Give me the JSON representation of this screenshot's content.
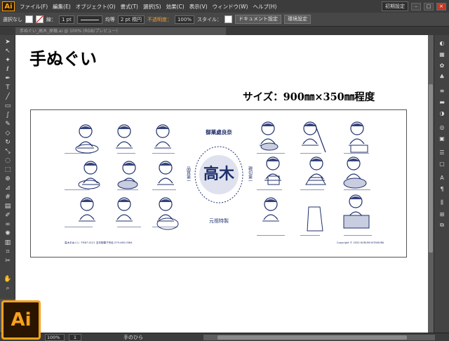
{
  "app": {
    "logo": "Ai",
    "menu": [
      "ファイル(F)",
      "編集(E)",
      "オブジェクト(O)",
      "書式(T)",
      "選択(S)",
      "効果(C)",
      "表示(V)",
      "ウィンドウ(W)",
      "ヘルプ(H)"
    ],
    "workspace": "初期設定",
    "window_controls": [
      "–",
      "□",
      "×"
    ]
  },
  "control_bar": {
    "selection": "選択なし",
    "stroke_label": "線：",
    "stroke_width": "1 pt",
    "profile": "均等",
    "brush": "2 pt 楕円",
    "opacity_label": "不透明度：",
    "opacity_value": "100%",
    "style_label": "スタイル：",
    "doc_settings": "ドキュメント設定",
    "prefs": "環境設定"
  },
  "tab": {
    "doc_name": "手ぬぐい_高木_原稿.ai @ 100% (RGB/プレビュー)"
  },
  "artboard": {
    "title": "手ぬぐい",
    "size": "サイズ：900㎜×350㎜程度"
  },
  "towel": {
    "emblem_top": "御菓處良奈",
    "emblem_left": "品質第一",
    "emblem_right": "親切第一",
    "emblem_main": "高木",
    "emblem_bottom": "元祖特製",
    "footer_left": "高木手ぬぐい 〒867-0121 沼本御菓子所処 079-465-0364",
    "footer_right": "Copyright © 2020 KURUMI KITAMURA"
  },
  "status": {
    "zoom": "100%",
    "page": "1",
    "tool": "手のひら"
  },
  "colors": {
    "accent": "#f7a21b",
    "ink": "#1f2f6b",
    "ui_dark": "#3c3c3c",
    "ui_mid": "#535353"
  },
  "icons": {
    "left_tools": [
      "selection-icon",
      "direct-selection-icon",
      "magic-wand-icon",
      "lasso-icon",
      "pen-icon",
      "type-icon",
      "line-icon",
      "rectangle-icon",
      "paintbrush-icon",
      "pencil-icon",
      "eraser-icon",
      "rotate-icon",
      "scale-icon",
      "warp-icon",
      "free-transform-icon",
      "shape-builder-icon",
      "perspective-icon",
      "mesh-icon",
      "gradient-icon",
      "eyedropper-icon",
      "blend-icon",
      "symbol-sprayer-icon",
      "graph-icon",
      "artboard-icon",
      "slice-icon",
      "hand-icon",
      "zoom-icon"
    ],
    "right_dock": [
      "color-panel-icon",
      "swatches-icon",
      "brushes-icon",
      "symbols-icon",
      "stroke-icon",
      "gradient-panel-icon",
      "transparency-icon",
      "appearance-icon",
      "graphic-styles-icon",
      "layers-icon",
      "artboards-icon",
      "type-panel-icon",
      "paragraph-icon",
      "align-icon",
      "transform-icon",
      "pathfinder-icon"
    ]
  }
}
